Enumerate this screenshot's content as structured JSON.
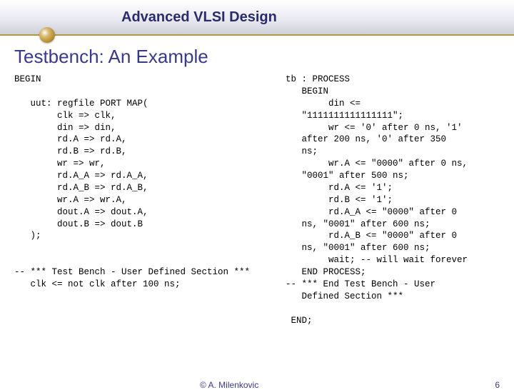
{
  "header": {
    "course": "Advanced VLSI Design"
  },
  "section": {
    "title": "Testbench: An Example"
  },
  "code": {
    "left": "BEGIN\n\n   uut: regfile PORT MAP(\n        clk => clk,\n        din => din,\n        rd.A => rd.A,\n        rd.B => rd.B,\n        wr => wr,\n        rd.A_A => rd.A_A,\n        rd.A_B => rd.A_B,\n        wr.A => wr.A,\n        dout.A => dout.A,\n        dout.B => dout.B\n   );\n\n\n-- *** Test Bench - User Defined Section ***\n   clk <= not clk after 100 ns;",
    "right": "tb : PROCESS\n   BEGIN\n        din <=\n   \"1111111111111111\";\n        wr <= '0' after 0 ns, '1'\n   after 200 ns, '0' after 350\n   ns;\n        wr.A <= \"0000\" after 0 ns,\n   \"0001\" after 500 ns;\n        rd.A <= '1';\n        rd.B <= '1';\n        rd.A_A <= \"0000\" after 0\n   ns, \"0001\" after 600 ns;\n        rd.A_B <= \"0000\" after 0\n   ns, \"0001\" after 600 ns;\n        wait; -- will wait forever\n   END PROCESS;\n-- *** End Test Bench - User\n   Defined Section ***\n\n END;"
  },
  "footer": {
    "author": "© A. Milenkovic",
    "page": "6"
  }
}
